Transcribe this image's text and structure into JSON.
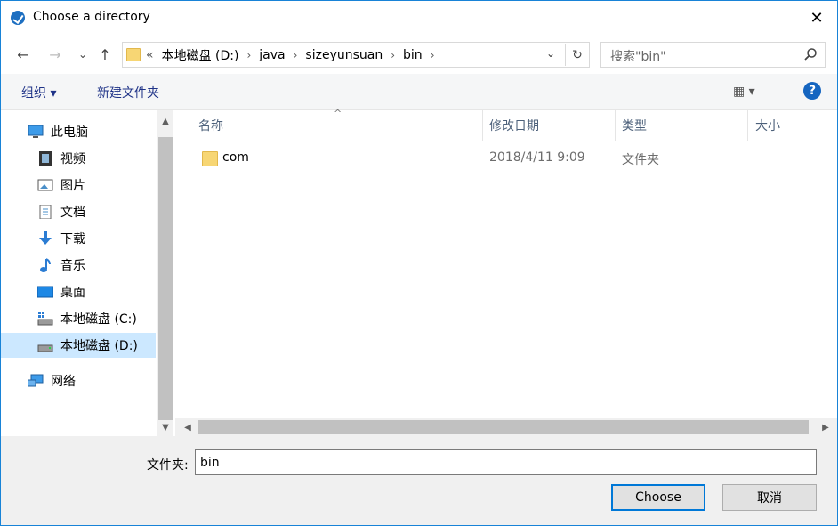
{
  "window": {
    "title": "Choose a directory"
  },
  "navigation": {
    "back_icon": "←",
    "forward_icon": "→",
    "recent_icon": "⌄",
    "up_icon": "↑",
    "breadcrumb_prefix": "«",
    "breadcrumbs": [
      "本地磁盘 (D:)",
      "java",
      "sizeyunsuan",
      "bin"
    ],
    "separator": "›",
    "refresh_icon": "↻",
    "search_placeholder": "搜索\"bin\""
  },
  "toolbar": {
    "organize_label": "组织 ▾",
    "new_folder_label": "新建文件夹",
    "view_label": "▦ ▾",
    "help_label": "?"
  },
  "sidebar": {
    "items": [
      {
        "label": "此电脑",
        "icon": "computer-icon"
      },
      {
        "label": "视频",
        "icon": "video-icon"
      },
      {
        "label": "图片",
        "icon": "picture-icon"
      },
      {
        "label": "文档",
        "icon": "document-icon"
      },
      {
        "label": "下载",
        "icon": "download-icon"
      },
      {
        "label": "音乐",
        "icon": "music-icon"
      },
      {
        "label": "桌面",
        "icon": "desktop-icon"
      },
      {
        "label": "本地磁盘 (C:)",
        "icon": "drive-icon"
      },
      {
        "label": "本地磁盘 (D:)",
        "icon": "drive-icon",
        "selected": true
      },
      {
        "label": "网络",
        "icon": "network-icon"
      }
    ]
  },
  "columns": {
    "name": "名称",
    "modified": "修改日期",
    "type": "类型",
    "size": "大小"
  },
  "files": [
    {
      "name": "com",
      "modified": "2018/4/11 9:09",
      "type": "文件夹"
    }
  ],
  "bottom": {
    "folder_label": "文件夹:",
    "folder_value": "bin",
    "choose_label": "Choose",
    "cancel_label": "取消"
  },
  "colors": {
    "accent": "#0078d7",
    "selection": "#cce8ff",
    "folder": "#f7d674"
  }
}
